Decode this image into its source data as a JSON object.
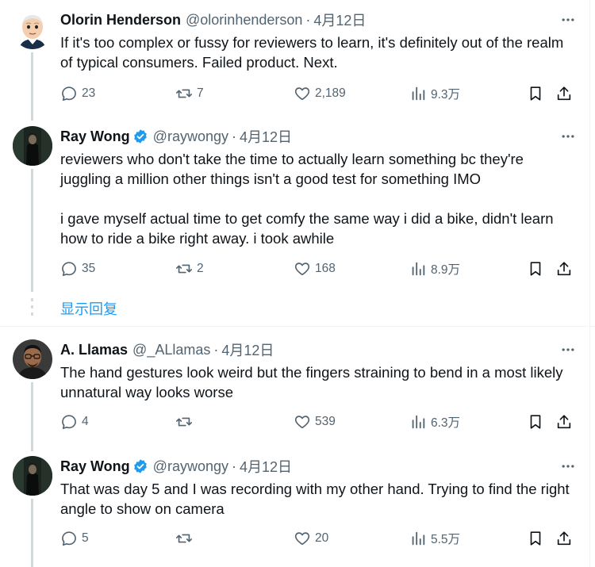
{
  "tweets": [
    {
      "name": "Olorin Henderson",
      "handle": "@olorinhenderson",
      "time": "4月12日",
      "verified": false,
      "text": "If it's too complex or fussy for reviewers to learn, it's definitely out of the realm of typical consumers. Failed product. Next.",
      "replies": "23",
      "retweets": "7",
      "likes": "2,189",
      "views": "9.3万"
    },
    {
      "name": "Ray Wong",
      "handle": "@raywongy",
      "time": "4月12日",
      "verified": true,
      "text": "reviewers who don't take the time to actually learn something bc they're juggling a million other things isn't a good test for something IMO\n\ni gave myself actual time to get comfy the same way i did a bike, didn't learn how to ride a bike right away. i took awhile",
      "replies": "35",
      "retweets": "2",
      "likes": "168",
      "views": "8.9万"
    },
    {
      "name": "A. Llamas",
      "handle": "@_ALlamas",
      "time": "4月12日",
      "verified": false,
      "text": "The hand gestures look weird but the fingers straining to bend in a most likely unnatural way looks worse",
      "replies": "4",
      "retweets": "",
      "likes": "539",
      "views": "6.3万"
    },
    {
      "name": "Ray Wong",
      "handle": "@raywongy",
      "time": "4月12日",
      "verified": true,
      "text": "That was day 5 and I was recording with my other hand. Trying to find the right angle to show on camera",
      "replies": "5",
      "retweets": "",
      "likes": "20",
      "views": "5.5万"
    }
  ],
  "show_replies": "显示回复",
  "separator": "·",
  "colors": {
    "accent": "#1d9bf0",
    "text": "#0f1419",
    "muted": "#536471",
    "thread_line": "#cfd9de"
  },
  "icons": [
    "more-icon",
    "reply-icon",
    "retweet-icon",
    "like-icon",
    "views-icon",
    "bookmark-icon",
    "share-icon",
    "verified-icon"
  ]
}
